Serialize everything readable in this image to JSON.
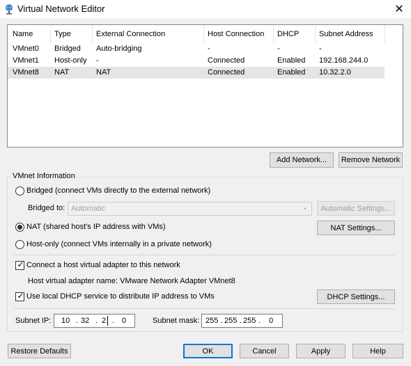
{
  "window": {
    "title": "Virtual Network Editor",
    "icon": "network-globe-icon",
    "close": "✕"
  },
  "table": {
    "headers": [
      "Name",
      "Type",
      "External Connection",
      "Host Connection",
      "DHCP",
      "Subnet Address"
    ],
    "rows": [
      {
        "name": "VMnet0",
        "type": "Bridged",
        "external": "Auto-bridging",
        "host": "-",
        "dhcp": "-",
        "subnet": "-"
      },
      {
        "name": "VMnet1",
        "type": "Host-only",
        "external": "-",
        "host": "Connected",
        "dhcp": "Enabled",
        "subnet": "192.168.244.0"
      },
      {
        "name": "VMnet8",
        "type": "NAT",
        "external": "NAT",
        "host": "Connected",
        "dhcp": "Enabled",
        "subnet": "10.32.2.0"
      }
    ],
    "selected_row": 2
  },
  "buttons": {
    "add_network": "Add Network...",
    "remove_network": "Remove Network",
    "automatic_settings": "Automatic Settings...",
    "nat_settings": "NAT Settings...",
    "dhcp_settings": "DHCP Settings...",
    "restore_defaults": "Restore Defaults",
    "ok": "OK",
    "cancel": "Cancel",
    "apply": "Apply",
    "help": "Help"
  },
  "vmnet_info": {
    "label": "VMnet Information",
    "bridged_radio": "Bridged (connect VMs directly to the external network)",
    "bridged_to_label": "Bridged to:",
    "bridged_to_value": "Automatic",
    "nat_radio": "NAT (shared host's IP address with VMs)",
    "hostonly_radio": "Host-only (connect VMs internally in a private network)",
    "selected_mode": "nat",
    "connect_adapter": "Connect a host virtual adapter to this network",
    "connect_adapter_checked": true,
    "adapter_name": "Host virtual adapter name: VMware Network Adapter VMnet8",
    "use_dhcp": "Use local DHCP service to distribute IP address to VMs",
    "use_dhcp_checked": true,
    "subnet_ip_label": "Subnet IP:",
    "subnet_ip": [
      "10",
      "32",
      "2",
      "0"
    ],
    "subnet_mask_label": "Subnet mask:",
    "subnet_mask": [
      "255",
      "255",
      "255",
      "0"
    ]
  },
  "colors": {
    "accent": "#0078d7",
    "selected_row": "#e5e5e5",
    "background": "#f0f0f0"
  }
}
